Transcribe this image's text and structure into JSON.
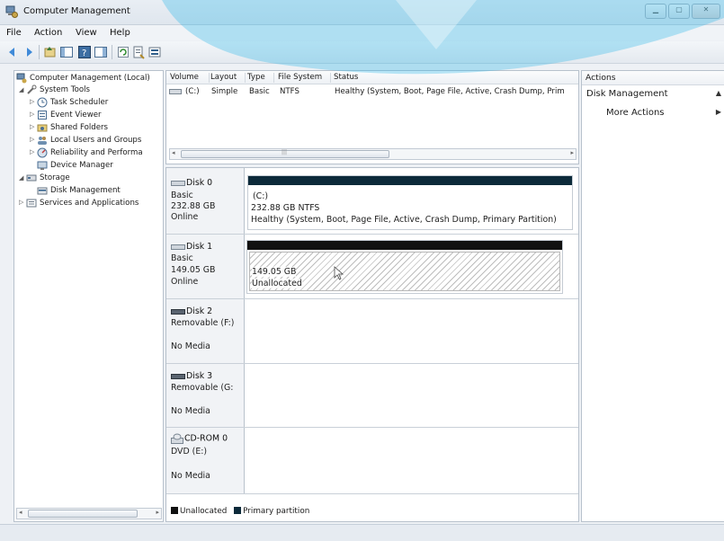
{
  "window": {
    "title": "Computer Management"
  },
  "menu": {
    "items": [
      "File",
      "Action",
      "View",
      "Help"
    ]
  },
  "tree": {
    "items": [
      "Computer Management (Local)",
      "System Tools",
      "Task Scheduler",
      "Event Viewer",
      "Shared Folders",
      "Local Users and Groups",
      "Reliability and Performa",
      "Device Manager",
      "Storage",
      "Disk Management",
      "Services and Applications"
    ]
  },
  "volumes": {
    "columns": [
      "Volume",
      "Layout",
      "Type",
      "File System",
      "Status"
    ],
    "rows": [
      {
        "volume": "(C:)",
        "layout": "Simple",
        "type": "Basic",
        "fs": "NTFS",
        "status": "Healthy (System, Boot, Page File, Active, Crash Dump, Prim"
      }
    ]
  },
  "disks": [
    {
      "name": "Disk 0",
      "type": "Basic",
      "size": "232.88 GB",
      "state": "Online",
      "part_title": "(C:)",
      "part_size": "232.88 GB NTFS",
      "part_status": "Healthy (System, Boot, Page File, Active, Crash Dump, Primary Partition)"
    },
    {
      "name": "Disk 1",
      "type": "Basic",
      "size": "149.05 GB",
      "state": "Online",
      "part_size": "149.05 GB",
      "part_status": "Unallocated"
    },
    {
      "name": "Disk 2",
      "type": "Removable (F:)",
      "state": "No Media"
    },
    {
      "name": "Disk 3",
      "type": "Removable (G:",
      "state": "No Media"
    },
    {
      "name": "CD-ROM 0",
      "type": "DVD (E:)",
      "state": "No Media"
    }
  ],
  "legend": {
    "unallocated": "Unallocated",
    "primary": "Primary partition"
  },
  "actions": {
    "header": "Actions",
    "section": "Disk Management",
    "more": "More Actions"
  },
  "colors": {
    "primary_partition": "#0c2a3a",
    "unallocated": "#111111",
    "watermark": "#29b6e8"
  }
}
